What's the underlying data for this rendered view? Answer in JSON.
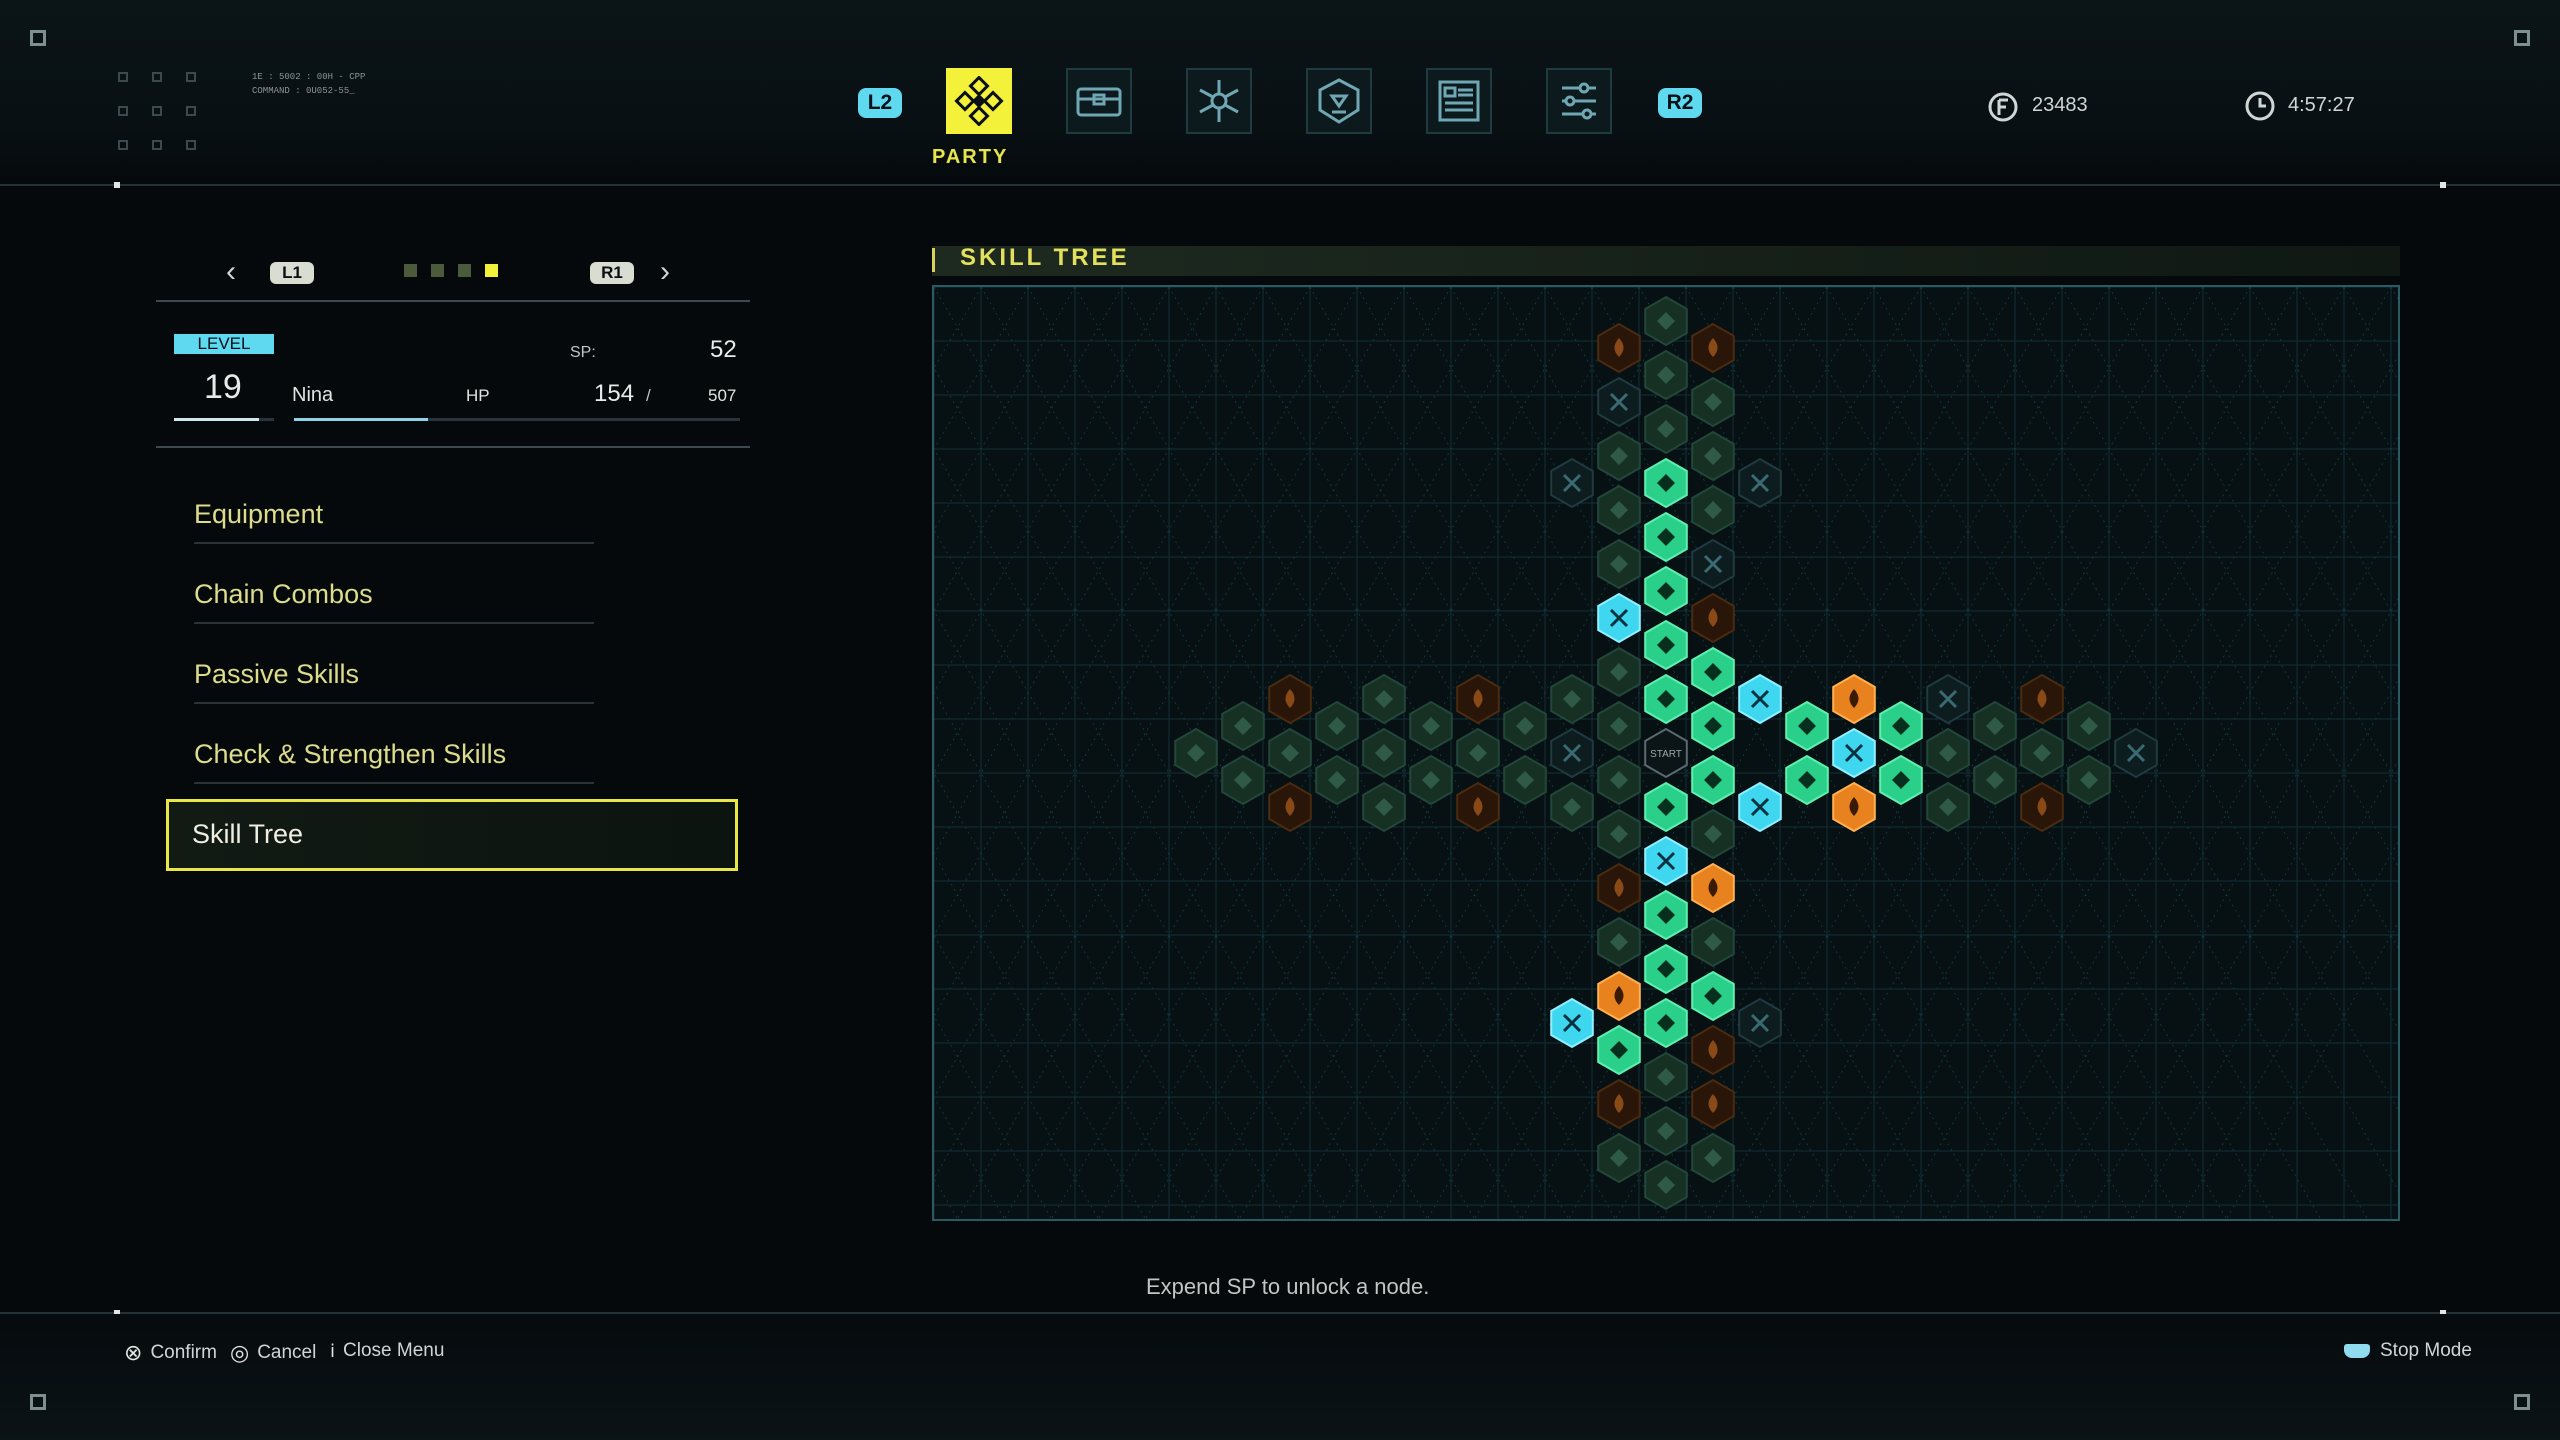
{
  "header": {
    "left_bumper": "L2",
    "right_bumper": "R2",
    "tabs": [
      {
        "id": "party",
        "icon": "party-icon",
        "active": true
      },
      {
        "id": "inventory",
        "icon": "chest-icon",
        "active": false
      },
      {
        "id": "tactics",
        "icon": "network-icon",
        "active": false
      },
      {
        "id": "journal",
        "icon": "badge-icon",
        "active": false
      },
      {
        "id": "data",
        "icon": "document-icon",
        "active": false
      },
      {
        "id": "settings",
        "icon": "sliders-icon",
        "active": false
      }
    ],
    "active_tab_label": "PARTY",
    "currency": "23483",
    "playtime": "4:57:27",
    "micro_text": [
      "1E : 5002 : 00H - CPP",
      "COMMAND : 0U052-55_"
    ],
    "accent_color": "#f4f13a",
    "chip_color": "#5fd9ef"
  },
  "character": {
    "prev_button": "L1",
    "next_button": "R1",
    "pager_count": 4,
    "pager_active": 4,
    "level_label": "LEVEL",
    "level": "19",
    "level_progress": 0.85,
    "name": "Nina",
    "sp_label": "SP:",
    "sp": "52",
    "hp_label": "HP",
    "hp": "154",
    "hp_sep": "/",
    "hp_max": "507",
    "hp_fraction": 0.3
  },
  "menu": {
    "items": [
      "Equipment",
      "Chain Combos",
      "Passive Skills",
      "Check & Strengthen Skills",
      "Skill Tree"
    ],
    "selected": 4
  },
  "skill_tree": {
    "title": "SKILL TREE",
    "start_label": "START",
    "hint": "Expend SP to unlock a node.",
    "colors": {
      "unlocked": "#2ad08a",
      "special": "#3fd7ef",
      "orange": "#e8821f",
      "locked": "#173024",
      "locked_border": "#23463a"
    }
  },
  "footer": {
    "confirm": "Confirm",
    "cancel": "Cancel",
    "close_menu": "Close Menu",
    "stop_mode": "Stop Mode"
  }
}
